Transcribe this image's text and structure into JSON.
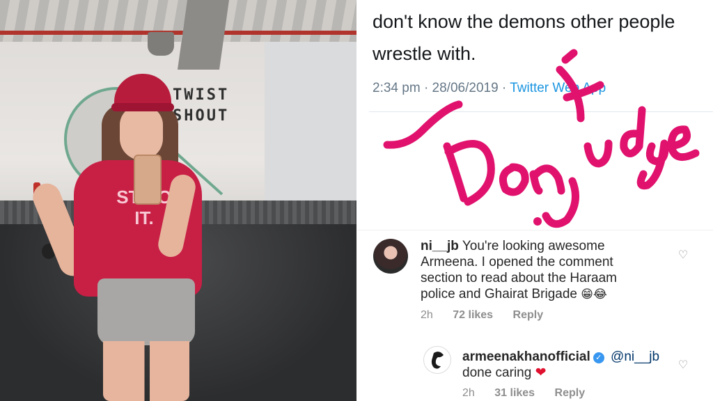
{
  "photo": {
    "wall_text_line1": "TWIST",
    "wall_text_line2": "SHOUT",
    "shirt_text": "ST DO IT."
  },
  "tweet": {
    "text": "don't know the demons other people wrestle with.",
    "time": "2:34 pm",
    "date": "28/06/2019",
    "source": "Twitter Web App",
    "separator": "·"
  },
  "handwriting": {
    "text": "Don't judge",
    "color": "#e0126e"
  },
  "comments": [
    {
      "username": "ni__jb",
      "text": "You're looking awesome Armeena. I opened the comment section to read about the Haraam police and Ghairat Brigade",
      "emojis": "😁😂",
      "age": "2h",
      "likes": "72 likes",
      "reply": "Reply"
    },
    {
      "username": "armeenakhanofficial",
      "verified": true,
      "mention": "@ni__jb",
      "text": "done caring",
      "emoji": "❤",
      "age": "2h",
      "likes": "31 likes",
      "reply": "Reply"
    }
  ],
  "icons": {
    "like": "heart-outline-icon",
    "verified": "verified-badge-icon"
  },
  "colors": {
    "link": "#1b95e0",
    "meta": "#8e8e8e",
    "heart": "#e0112f",
    "verified": "#3897f0"
  }
}
